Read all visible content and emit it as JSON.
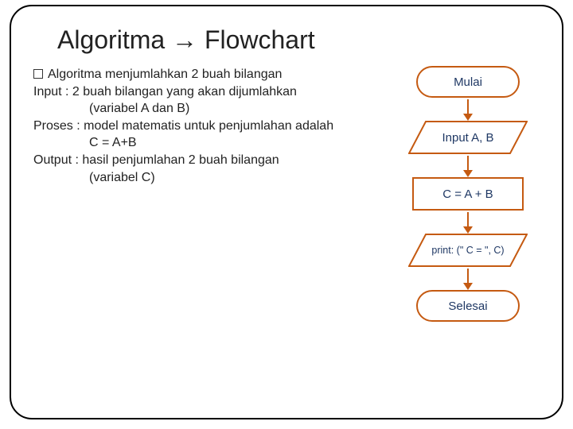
{
  "title": "Algoritma → Flowchart",
  "body": {
    "bullet": "Algoritma menjumlahkan 2 buah bilangan",
    "input_line": "Input : 2 buah bilangan yang akan dijumlahkan",
    "input_vars": "(variabel A dan B)",
    "proses_line": "Proses : model matematis untuk penjumlahan adalah",
    "proses_formula": "C = A+B",
    "output_line": "Output : hasil penjumlahan 2 buah bilangan",
    "output_vars": "(variabel C)"
  },
  "flow": {
    "start": "Mulai",
    "input": "Input A, B",
    "process": "C = A + B",
    "output": "print: (\" C = \", C)",
    "end": "Selesai"
  },
  "colors": {
    "accent": "#c55a11",
    "text": "#1f3864"
  }
}
